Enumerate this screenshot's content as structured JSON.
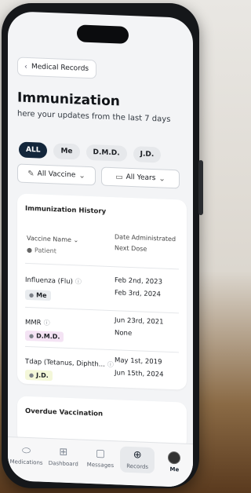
{
  "back": {
    "label": "Medical Records"
  },
  "title": "Immunization",
  "subtitle": "here your updates from the last 7 days",
  "people": [
    "ALL",
    "Me",
    "D.M.D.",
    "J.D."
  ],
  "filters": {
    "vaccine": "All Vaccine",
    "years": "All Years"
  },
  "history": {
    "title": "Immunization History",
    "col_left": "Vaccine Name",
    "col_left_sub": "Patient",
    "col_right": "Date Administrated",
    "col_right_sub": "Next Dose",
    "rows": [
      {
        "name": "Influenza (Flu)",
        "patient": "Me",
        "date": "Feb 2nd, 2023",
        "next": "Feb 3rd, 2024",
        "color": "#e9ecef"
      },
      {
        "name": "MMR",
        "patient": "D.M.D.",
        "date": "Jun 23rd, 2021",
        "next": "None",
        "color": "#f4e3f4"
      },
      {
        "name": "Tdap (Tetanus, Diphth...",
        "patient": "J.D.",
        "date": "May 1st, 2019",
        "next": "Jun 15th, 2024",
        "color": "#f4f7d9"
      }
    ]
  },
  "overdue": {
    "title": "Overdue Vaccination"
  },
  "tabs": [
    {
      "label": "Medications",
      "icon": "pill-icon"
    },
    {
      "label": "Dashboard",
      "icon": "grid-icon"
    },
    {
      "label": "Messages",
      "icon": "message-icon"
    },
    {
      "label": "Records",
      "icon": "records-icon",
      "active": true
    },
    {
      "label": "Me",
      "icon": "avatar"
    }
  ]
}
